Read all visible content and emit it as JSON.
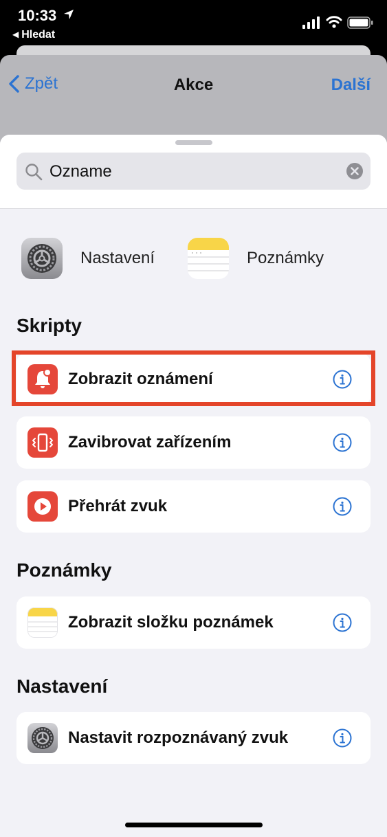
{
  "status_bar": {
    "time": "10:33",
    "back_app": "Hledat"
  },
  "nav": {
    "back_label": "Zpět",
    "title": "Akce",
    "next_label": "Další"
  },
  "search": {
    "value": "Ozname",
    "display": "Ozname"
  },
  "apps": [
    {
      "label": "Nastavení",
      "icon": "settings-icon"
    },
    {
      "label": "Poznámky",
      "icon": "notes-icon"
    }
  ],
  "sections": [
    {
      "title": "Skripty",
      "items": [
        {
          "label": "Zobrazit oznámení",
          "icon": "notification-bell-icon",
          "highlighted": true
        },
        {
          "label": "Zavibrovat zařízením",
          "icon": "vibrate-icon"
        },
        {
          "label": "Přehrát zvuk",
          "icon": "play-sound-icon"
        }
      ]
    },
    {
      "title": "Poznámky",
      "items": [
        {
          "label": "Zobrazit složku poznámek",
          "icon": "notes-icon"
        }
      ]
    },
    {
      "title": "Nastavení",
      "items": [
        {
          "label": "Nastavit rozpoznávaný zvuk",
          "icon": "settings-icon"
        }
      ]
    }
  ],
  "colors": {
    "accent": "#2b73d2",
    "highlight": "#e4452a",
    "script_red": "#e5473a"
  }
}
